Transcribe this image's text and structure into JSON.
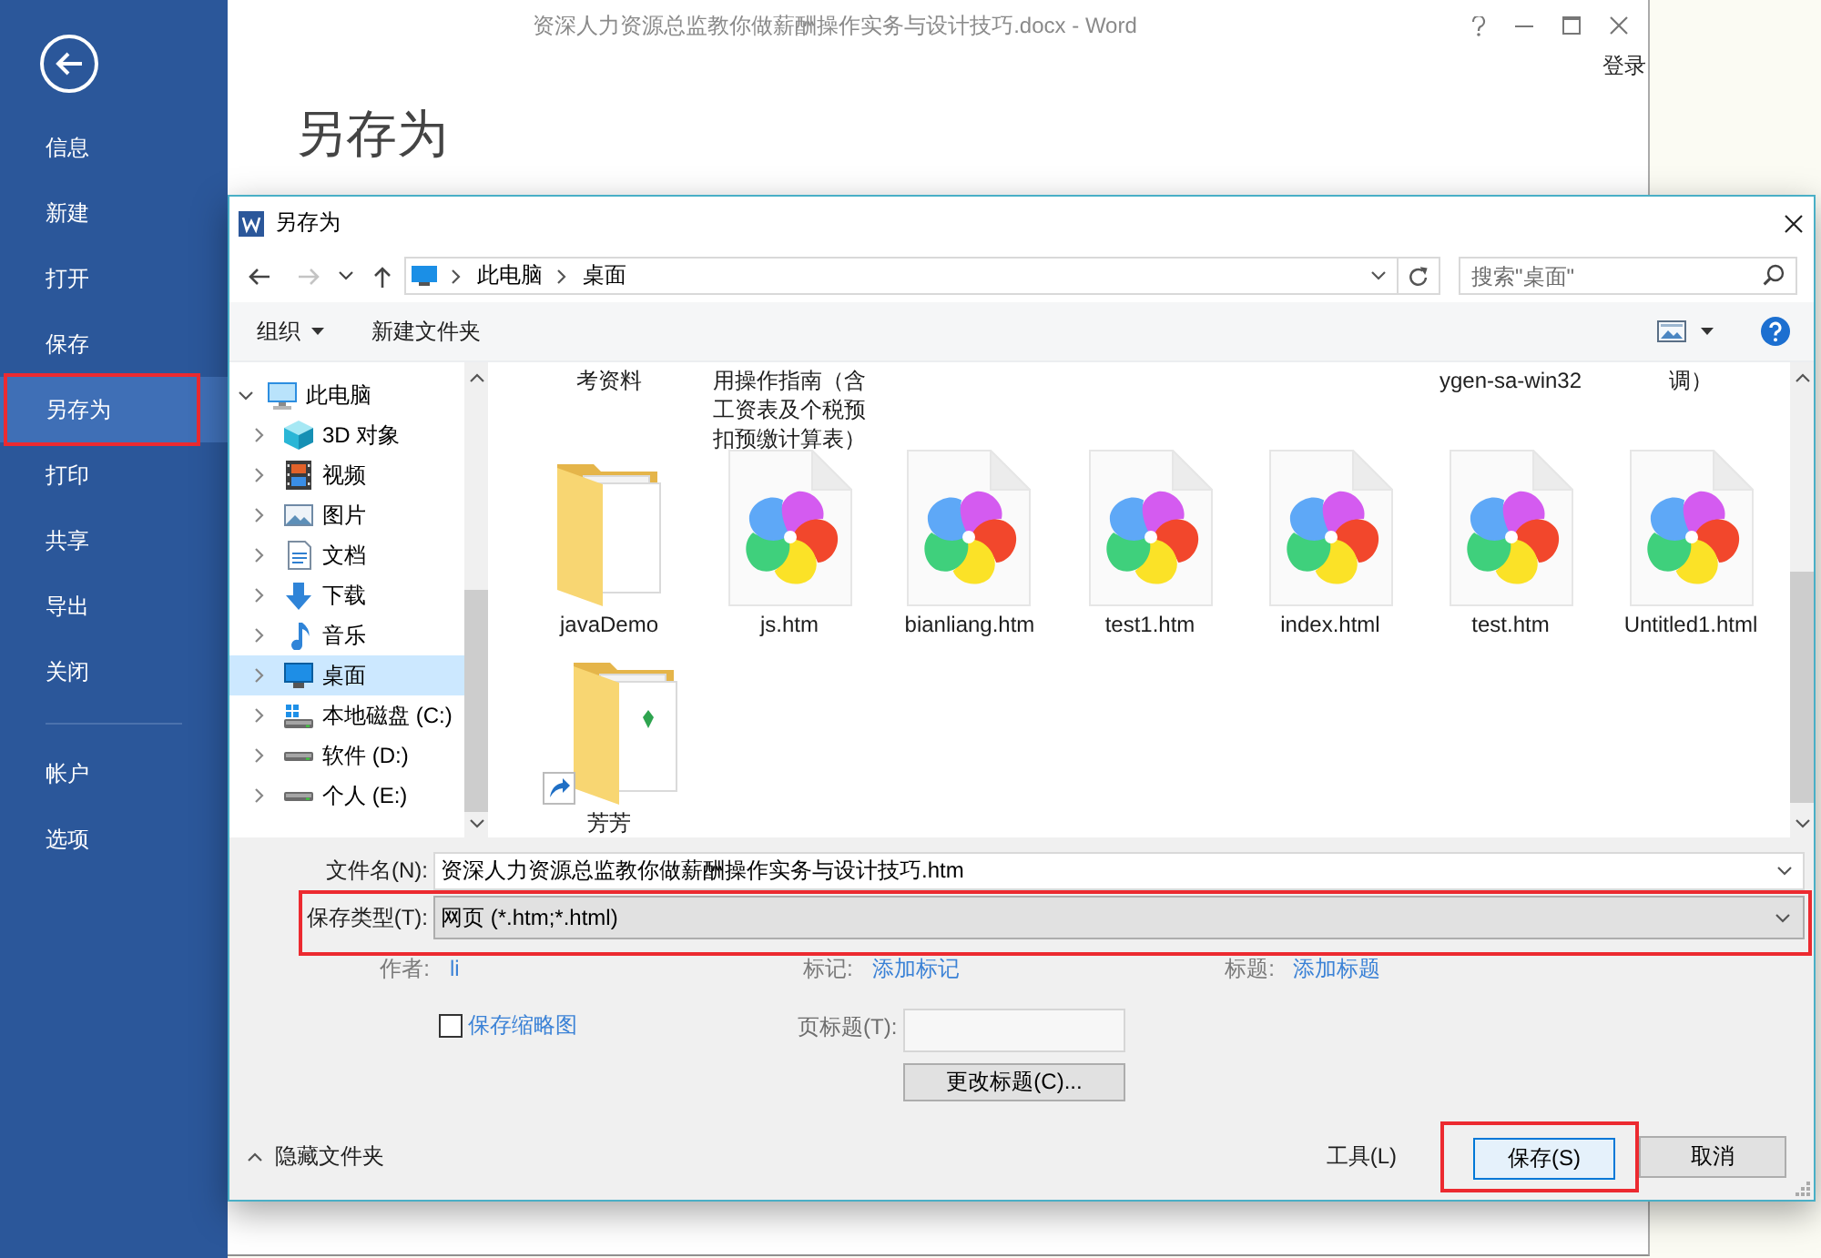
{
  "word_window": {
    "title": "资深人力资源总监教你做薪酬操作实务与设计技巧.docx - Word",
    "sign_in": "登录",
    "heading": "另存为"
  },
  "sidebar": {
    "items": [
      {
        "label": "信息",
        "selected": false,
        "highlighted": false
      },
      {
        "label": "新建",
        "selected": false,
        "highlighted": false
      },
      {
        "label": "打开",
        "selected": false,
        "highlighted": false
      },
      {
        "label": "保存",
        "selected": false,
        "highlighted": false
      },
      {
        "label": "另存为",
        "selected": true,
        "highlighted": true
      },
      {
        "label": "打印",
        "selected": false,
        "highlighted": false
      },
      {
        "label": "共享",
        "selected": false,
        "highlighted": false
      },
      {
        "label": "导出",
        "selected": false,
        "highlighted": false
      },
      {
        "label": "关闭",
        "selected": false,
        "highlighted": false
      }
    ],
    "bottom_items": [
      {
        "label": "帐户",
        "selected": false,
        "highlighted": false
      },
      {
        "label": "选项",
        "selected": false,
        "highlighted": false
      }
    ]
  },
  "dialog": {
    "title": "另存为",
    "nav_buttons": [
      {
        "kind": "back",
        "disabled": false
      },
      {
        "kind": "forward",
        "disabled": true
      },
      {
        "kind": "recent",
        "disabled": false
      },
      {
        "kind": "up",
        "disabled": false
      }
    ],
    "breadcrumb": [
      "此电脑",
      "桌面"
    ],
    "search": {
      "placeholder": "搜索\"桌面\""
    },
    "toolbar": {
      "organize": "组织",
      "new_folder": "新建文件夹"
    },
    "nav_tree": [
      {
        "kind": "computer",
        "label": "此电脑",
        "expanded": true,
        "selected": false,
        "children": [
          {
            "kind": "objects3d",
            "label": "3D 对象",
            "expanded": false,
            "selected": false
          },
          {
            "kind": "videos",
            "label": "视频",
            "expanded": false,
            "selected": false
          },
          {
            "kind": "pictures",
            "label": "图片",
            "expanded": false,
            "selected": false
          },
          {
            "kind": "documents",
            "label": "文档",
            "expanded": false,
            "selected": false
          },
          {
            "kind": "downloads",
            "label": "下载",
            "expanded": false,
            "selected": false
          },
          {
            "kind": "music",
            "label": "音乐",
            "expanded": false,
            "selected": false
          },
          {
            "kind": "desktop",
            "label": "桌面",
            "expanded": false,
            "selected": true
          },
          {
            "kind": "system_drive",
            "label": "本地磁盘 (C:)",
            "expanded": false,
            "selected": false
          },
          {
            "kind": "drive",
            "label": "软件 (D:)",
            "expanded": false,
            "selected": false
          },
          {
            "kind": "drive",
            "label": "个人 (E:)",
            "expanded": false,
            "selected": false
          }
        ]
      }
    ],
    "captions_cut_off": {
      "start": [
        {
          "lines": [
            "考资料"
          ]
        },
        {
          "lines": [
            "用操作指南（含",
            "工资表及个税预",
            "扣预缴计算表）"
          ]
        }
      ],
      "end": [
        {
          "lines": [
            "ygen-sa-win32"
          ]
        },
        {
          "lines": [
            "调）"
          ]
        }
      ]
    },
    "files": [
      {
        "kind": "folder",
        "label": "javaDemo"
      },
      {
        "kind": "web_page",
        "label": "js.htm"
      },
      {
        "kind": "web_page",
        "label": "bianliang.htm"
      },
      {
        "kind": "web_page",
        "label": "test1.htm"
      },
      {
        "kind": "web_page",
        "label": "index.html"
      },
      {
        "kind": "web_page",
        "label": "test.htm"
      },
      {
        "kind": "web_page",
        "label": "Untitled1.html"
      },
      {
        "kind": "folder_shortcut",
        "label": "芳芳"
      }
    ],
    "form": {
      "filename": {
        "label": "文件名(N):",
        "value": "资深人力资源总监教你做薪酬操作实务与设计技巧.htm"
      },
      "save_type": {
        "label": "保存类型(T):",
        "value": "网页 (*.htm;*.html)",
        "highlighted": true
      },
      "metadata": [
        {
          "label": "作者:",
          "value": "li"
        },
        {
          "label": "标记:",
          "value": "添加标记"
        },
        {
          "label": "标题:",
          "value": "添加标题"
        }
      ],
      "thumbnail": {
        "label": "保存缩略图",
        "checked": false
      },
      "page_title": {
        "label": "页标题(T):"
      },
      "change_title_button": "更改标题(C)...",
      "hide_folders": "隐藏文件夹",
      "tools": "工具(L)"
    },
    "buttons": [
      {
        "kind": "save",
        "label": "保存(S)",
        "default": true,
        "highlighted": true
      },
      {
        "kind": "cancel",
        "label": "取消",
        "default": false,
        "highlighted": false
      }
    ]
  }
}
